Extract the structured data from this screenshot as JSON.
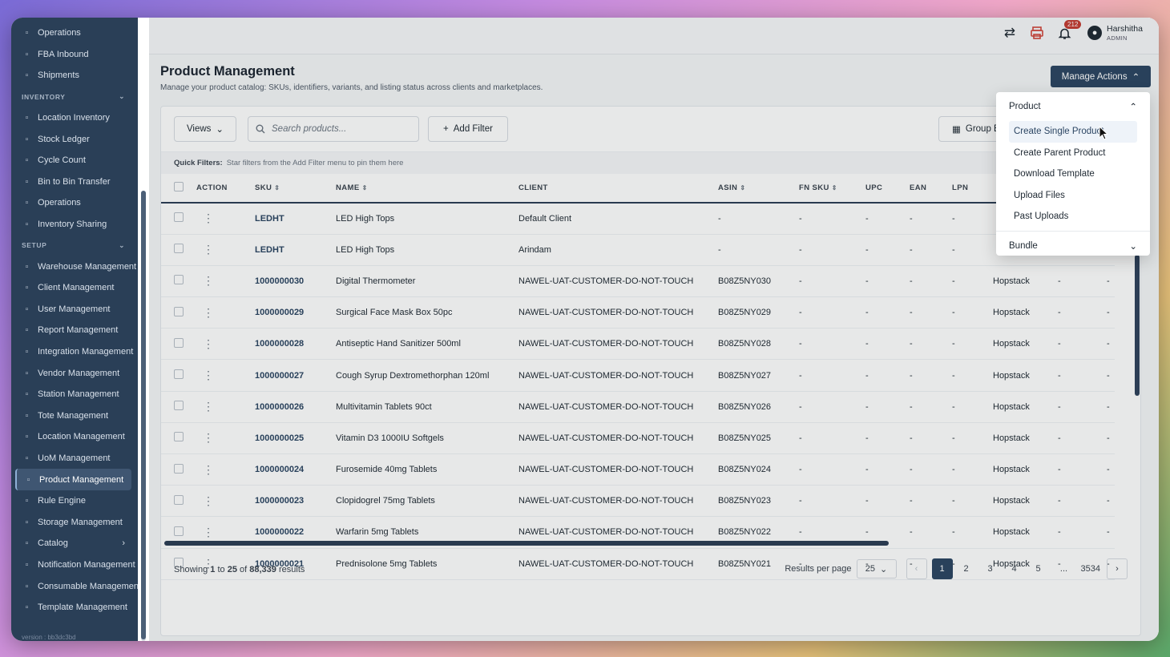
{
  "sidebar": {
    "items_top": [
      {
        "label": "Operations",
        "icon": "home-icon"
      },
      {
        "label": "FBA Inbound",
        "icon": "box-icon"
      },
      {
        "label": "Shipments",
        "icon": "truck-icon"
      }
    ],
    "inventory_header": "INVENTORY",
    "inventory_items": [
      {
        "label": "Location Inventory",
        "icon": "bar-chart-icon"
      },
      {
        "label": "Stock Ledger",
        "icon": "ledger-icon"
      },
      {
        "label": "Cycle Count",
        "icon": "refresh-icon"
      },
      {
        "label": "Bin to Bin Transfer",
        "icon": "transfer-icon"
      },
      {
        "label": "Operations",
        "icon": "cube-icon"
      },
      {
        "label": "Inventory Sharing",
        "icon": "share-icon"
      }
    ],
    "setup_header": "SETUP",
    "setup_items": [
      {
        "label": "Warehouse Management",
        "icon": "warehouse-icon"
      },
      {
        "label": "Client Management",
        "icon": "briefcase-icon"
      },
      {
        "label": "User Management",
        "icon": "users-icon"
      },
      {
        "label": "Report Management",
        "icon": "chart-icon"
      },
      {
        "label": "Integration Management",
        "icon": "link-icon"
      },
      {
        "label": "Vendor Management",
        "icon": "store-icon"
      },
      {
        "label": "Station Management",
        "icon": "monitor-icon"
      },
      {
        "label": "Tote Management",
        "icon": "lock-icon"
      },
      {
        "label": "Location Management",
        "icon": "building-icon"
      },
      {
        "label": "UoM Management",
        "icon": "ruler-icon"
      },
      {
        "label": "Product Management",
        "icon": "tag-icon"
      },
      {
        "label": "Rule Engine",
        "icon": "flow-icon"
      },
      {
        "label": "Storage Management",
        "icon": "storage-icon"
      },
      {
        "label": "Catalog",
        "icon": "catalog-icon"
      },
      {
        "label": "Notification Management",
        "icon": "bell-icon"
      },
      {
        "label": "Consumable Management",
        "icon": "gear-icon"
      },
      {
        "label": "Template Management",
        "icon": "template-icon"
      }
    ],
    "version": "version : bb3dc3bd"
  },
  "topbar": {
    "notification_count": "212",
    "user_name": "Harshitha",
    "user_role": "ADMIN"
  },
  "page": {
    "title": "Product Management",
    "subtitle": "Manage your product catalog: SKUs, identifiers, variants, and listing status across clients and marketplaces.",
    "manage_actions_label": "Manage Actions"
  },
  "toolbar": {
    "views_label": "Views",
    "search_placeholder": "Search products...",
    "add_filter_label": "Add Filter",
    "group_label": "Group By"
  },
  "quick_filters": {
    "label": "Quick Filters:",
    "hint": "Star filters from the Add Filter menu to pin them here"
  },
  "table": {
    "headers": [
      "ACTION",
      "SKU",
      "NAME",
      "CLIENT",
      "ASIN",
      "FN SKU",
      "UPC",
      "EAN",
      "LPN",
      "",
      "",
      ""
    ],
    "rows": [
      {
        "sku": "LEDHT",
        "name": "LED High Tops",
        "client": "Default Client",
        "asin": "-",
        "fnsku": "-",
        "upc": "-",
        "ean": "-",
        "lpn": "-",
        "brand": "",
        "c10": "",
        "c11": ""
      },
      {
        "sku": "LEDHT",
        "name": "LED High Tops",
        "client": "Arindam",
        "asin": "-",
        "fnsku": "-",
        "upc": "-",
        "ean": "-",
        "lpn": "-",
        "brand": "",
        "c10": "",
        "c11": ""
      },
      {
        "sku": "1000000030",
        "name": "Digital Thermometer",
        "client": "NAWEL-UAT-CUSTOMER-DO-NOT-TOUCH",
        "asin": "B08Z5NY030",
        "fnsku": "-",
        "upc": "-",
        "ean": "-",
        "lpn": "-",
        "brand": "Hopstack",
        "c10": "-",
        "c11": "-"
      },
      {
        "sku": "1000000029",
        "name": "Surgical Face Mask Box 50pc",
        "client": "NAWEL-UAT-CUSTOMER-DO-NOT-TOUCH",
        "asin": "B08Z5NY029",
        "fnsku": "-",
        "upc": "-",
        "ean": "-",
        "lpn": "-",
        "brand": "Hopstack",
        "c10": "-",
        "c11": "-"
      },
      {
        "sku": "1000000028",
        "name": "Antiseptic Hand Sanitizer 500ml",
        "client": "NAWEL-UAT-CUSTOMER-DO-NOT-TOUCH",
        "asin": "B08Z5NY028",
        "fnsku": "-",
        "upc": "-",
        "ean": "-",
        "lpn": "-",
        "brand": "Hopstack",
        "c10": "-",
        "c11": "-"
      },
      {
        "sku": "1000000027",
        "name": "Cough Syrup Dextromethorphan 120ml",
        "client": "NAWEL-UAT-CUSTOMER-DO-NOT-TOUCH",
        "asin": "B08Z5NY027",
        "fnsku": "-",
        "upc": "-",
        "ean": "-",
        "lpn": "-",
        "brand": "Hopstack",
        "c10": "-",
        "c11": "-"
      },
      {
        "sku": "1000000026",
        "name": "Multivitamin Tablets 90ct",
        "client": "NAWEL-UAT-CUSTOMER-DO-NOT-TOUCH",
        "asin": "B08Z5NY026",
        "fnsku": "-",
        "upc": "-",
        "ean": "-",
        "lpn": "-",
        "brand": "Hopstack",
        "c10": "-",
        "c11": "-"
      },
      {
        "sku": "1000000025",
        "name": "Vitamin D3 1000IU Softgels",
        "client": "NAWEL-UAT-CUSTOMER-DO-NOT-TOUCH",
        "asin": "B08Z5NY025",
        "fnsku": "-",
        "upc": "-",
        "ean": "-",
        "lpn": "-",
        "brand": "Hopstack",
        "c10": "-",
        "c11": "-"
      },
      {
        "sku": "1000000024",
        "name": "Furosemide 40mg Tablets",
        "client": "NAWEL-UAT-CUSTOMER-DO-NOT-TOUCH",
        "asin": "B08Z5NY024",
        "fnsku": "-",
        "upc": "-",
        "ean": "-",
        "lpn": "-",
        "brand": "Hopstack",
        "c10": "-",
        "c11": "-"
      },
      {
        "sku": "1000000023",
        "name": "Clopidogrel 75mg Tablets",
        "client": "NAWEL-UAT-CUSTOMER-DO-NOT-TOUCH",
        "asin": "B08Z5NY023",
        "fnsku": "-",
        "upc": "-",
        "ean": "-",
        "lpn": "-",
        "brand": "Hopstack",
        "c10": "-",
        "c11": "-"
      },
      {
        "sku": "1000000022",
        "name": "Warfarin 5mg Tablets",
        "client": "NAWEL-UAT-CUSTOMER-DO-NOT-TOUCH",
        "asin": "B08Z5NY022",
        "fnsku": "-",
        "upc": "-",
        "ean": "-",
        "lpn": "-",
        "brand": "Hopstack",
        "c10": "-",
        "c11": "-"
      },
      {
        "sku": "1000000021",
        "name": "Prednisolone 5mg Tablets",
        "client": "NAWEL-UAT-CUSTOMER-DO-NOT-TOUCH",
        "asin": "B08Z5NY021",
        "fnsku": "-",
        "upc": "-",
        "ean": "-",
        "lpn": "-",
        "brand": "Hopstack",
        "c10": "-",
        "c11": "-"
      }
    ]
  },
  "footer": {
    "showing_prefix": "Showing",
    "from": "1",
    "to_word": "to",
    "to": "25",
    "of_word": "of",
    "total": "88,339",
    "results_word": "results",
    "results_per_page_label": "Results per page",
    "per_page_value": "25",
    "pages": [
      "1",
      "2",
      "3",
      "4",
      "5"
    ],
    "ellipsis": "...",
    "last_page": "3534"
  },
  "dropdown": {
    "product_header": "Product",
    "product_items": [
      "Create Single Product",
      "Create Parent Product",
      "Download Template",
      "Upload Files",
      "Past Uploads"
    ],
    "bundle_header": "Bundle"
  },
  "colors": {
    "sidebar_bg": "#2a3f57",
    "primary": "#2c4663",
    "badge": "#c43b33"
  }
}
